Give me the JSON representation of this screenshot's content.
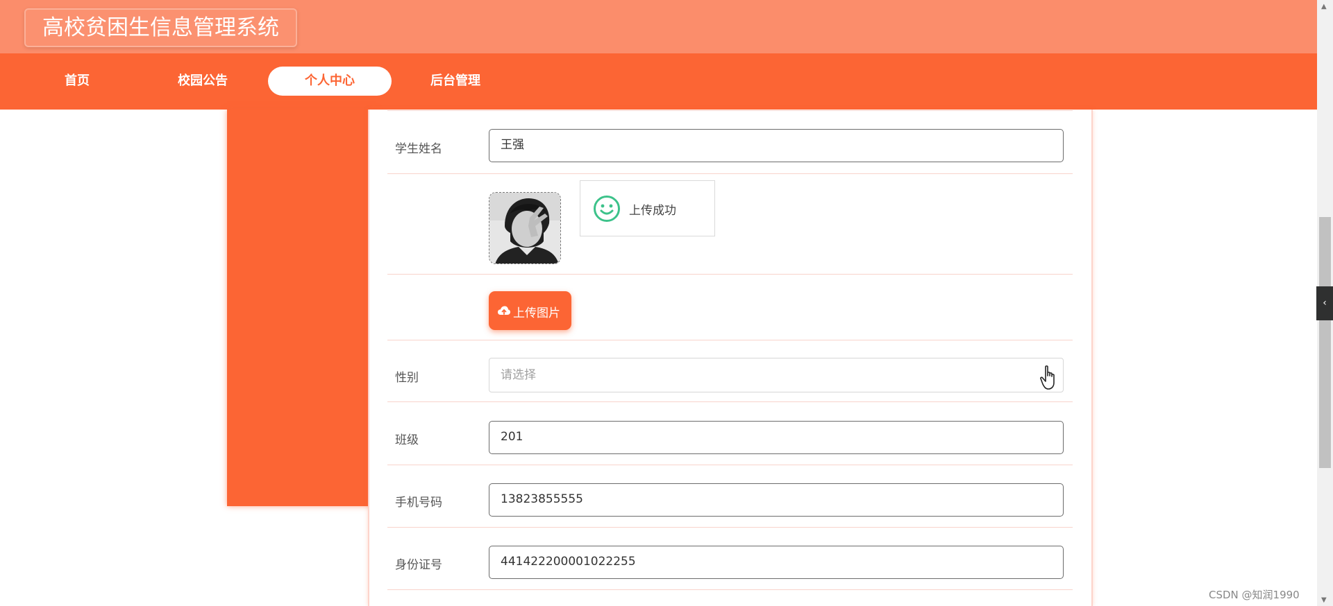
{
  "app": {
    "title": "高校贫困生信息管理系统"
  },
  "nav": {
    "items": [
      {
        "label": "首页"
      },
      {
        "label": "校园公告"
      },
      {
        "label": "个人中心"
      },
      {
        "label": "后台管理"
      }
    ],
    "active_index": 2
  },
  "form": {
    "student_name": {
      "label": "学生姓名",
      "value": "王强"
    },
    "upload_toast": {
      "text": "上传成功",
      "icon": "smile-icon"
    },
    "upload_button": {
      "label": "上传图片",
      "icon": "cloud-upload-icon"
    },
    "gender": {
      "label": "性别",
      "placeholder": "请选择"
    },
    "class": {
      "label": "班级",
      "value": "201"
    },
    "phone": {
      "label": "手机号码",
      "value": "13823855555"
    },
    "id_number": {
      "label": "身份证号",
      "value": "441422200001022255"
    }
  },
  "side_toggle": {
    "label": "‹"
  },
  "scrollbar": {
    "up": "▲",
    "down": "▼"
  },
  "watermark": "CSDN @知润1990",
  "colors": {
    "title_bar": "#fb8d6b",
    "nav_bar": "#fc6534",
    "accent": "#fc6534",
    "success": "#3cc28a"
  }
}
